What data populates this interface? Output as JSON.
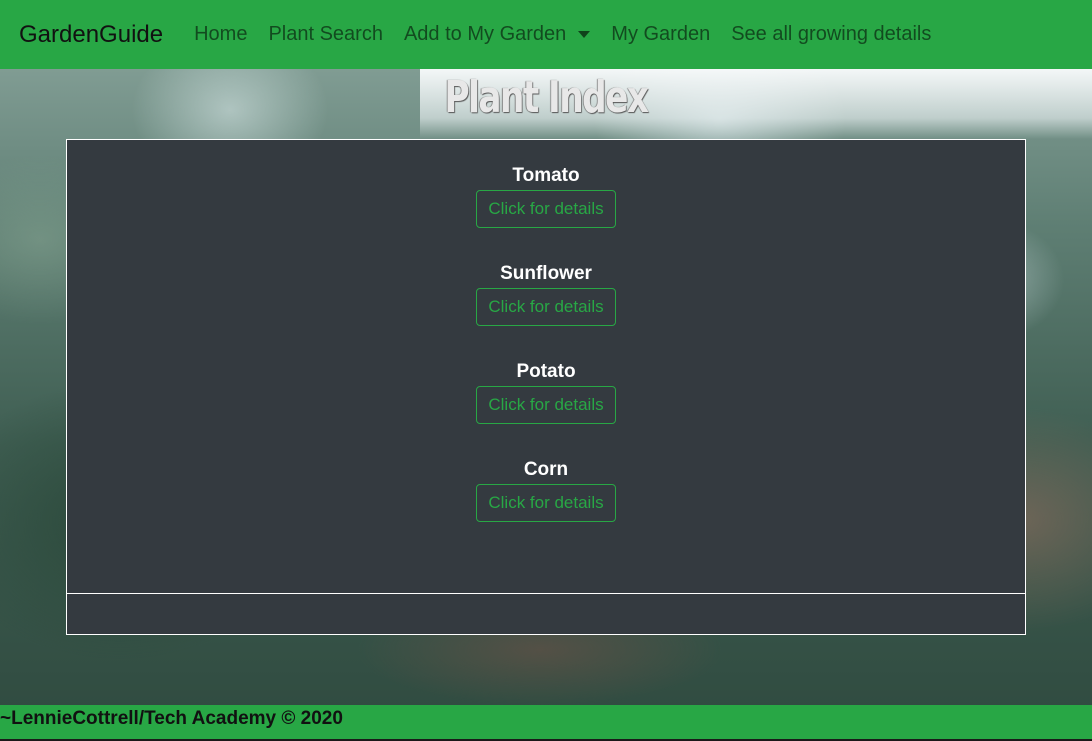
{
  "navbar": {
    "brand": "GardenGuide",
    "links": [
      {
        "label": "Home"
      },
      {
        "label": "Plant Search"
      },
      {
        "label": "Add to My Garden"
      },
      {
        "label": "My Garden"
      },
      {
        "label": "See all growing details"
      }
    ]
  },
  "page": {
    "title": "Plant Index"
  },
  "plants": [
    {
      "name": "Tomato",
      "button": "Click for details"
    },
    {
      "name": "Sunflower",
      "button": "Click for details"
    },
    {
      "name": "Potato",
      "button": "Click for details"
    },
    {
      "name": "Corn",
      "button": "Click for details"
    }
  ],
  "footer": {
    "text": "~LennieCottrell/Tech Academy © 2020"
  },
  "colors": {
    "brand_green": "#28a745",
    "panel_dark": "#343a40",
    "text_white": "#ffffff"
  },
  "icons": {
    "dropdown": "chevron-down-icon"
  }
}
